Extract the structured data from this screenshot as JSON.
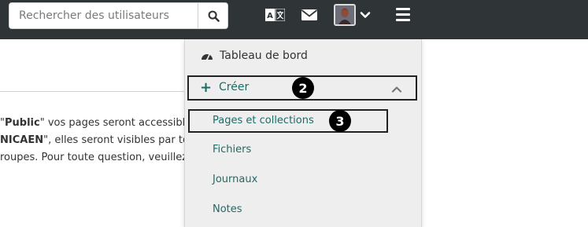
{
  "header": {
    "search": {
      "placeholder": "Rechercher des utilisateurs",
      "value": ""
    },
    "icons": [
      "search-icon",
      "language-icon",
      "mail-icon",
      "avatar",
      "chevron-down-icon",
      "menu-icon"
    ]
  },
  "page": {
    "lines": [
      {
        "pre": "\"",
        "bold": "Public",
        "post": "\" vos pages seront accessibles"
      },
      {
        "pre": "",
        "bold": "NICAEN",
        "post": "\", elles seront visibles par tous"
      },
      {
        "pre": "",
        "bold": "",
        "post": "roupes. Pour toute question, veuillez"
      }
    ]
  },
  "menu": {
    "dashboard": "Tableau de bord",
    "create": "Créer",
    "items": [
      "Pages et collections",
      "Fichiers",
      "Journaux",
      "Notes"
    ]
  },
  "badges": {
    "create": "2",
    "pages": "3"
  },
  "colors": {
    "topbar": "#2f3437",
    "link": "#1e6b65",
    "menu_bg": "#eeeeee"
  }
}
